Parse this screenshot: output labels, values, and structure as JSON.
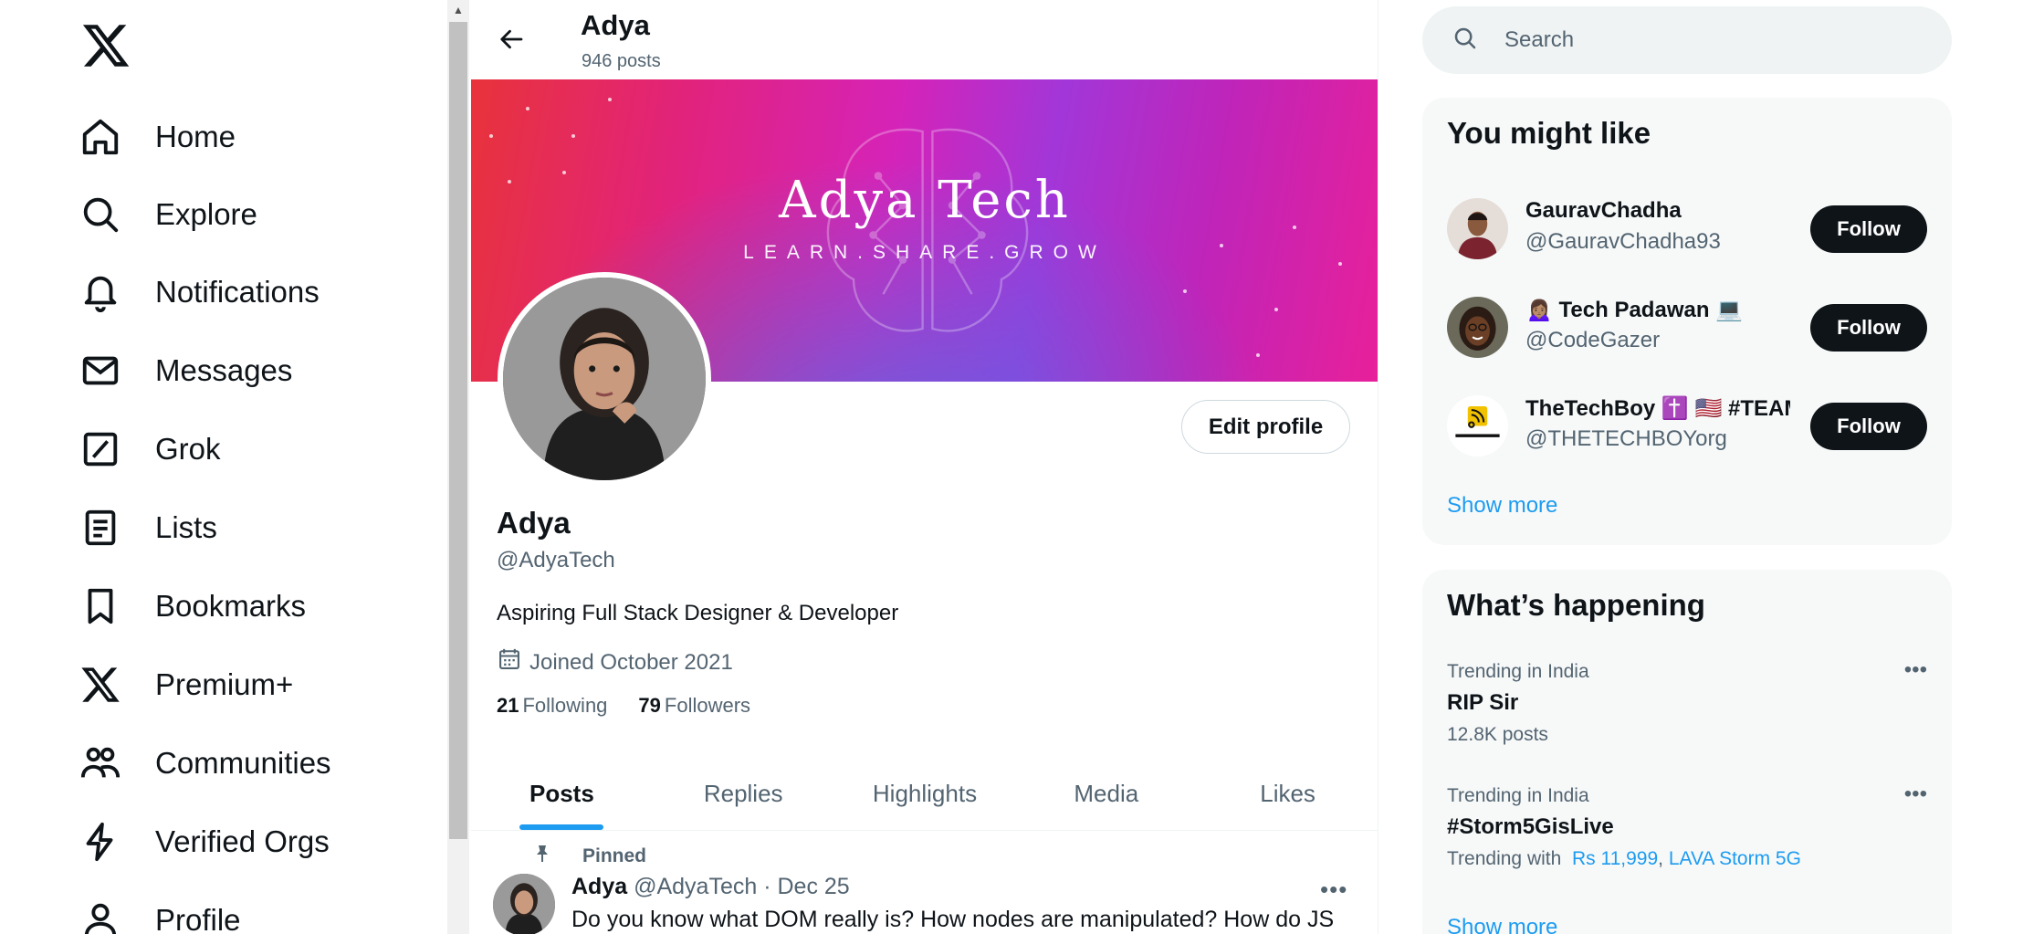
{
  "nav": {
    "items": [
      {
        "label": "Home",
        "icon": "home-icon"
      },
      {
        "label": "Explore",
        "icon": "search-icon"
      },
      {
        "label": "Notifications",
        "icon": "bell-icon"
      },
      {
        "label": "Messages",
        "icon": "envelope-icon"
      },
      {
        "label": "Grok",
        "icon": "grok-icon"
      },
      {
        "label": "Lists",
        "icon": "list-icon"
      },
      {
        "label": "Bookmarks",
        "icon": "bookmark-icon"
      },
      {
        "label": "Premium+",
        "icon": "x-logo-icon"
      },
      {
        "label": "Communities",
        "icon": "people-icon"
      },
      {
        "label": "Verified Orgs",
        "icon": "lightning-icon"
      },
      {
        "label": "Profile",
        "icon": "person-icon"
      }
    ]
  },
  "header": {
    "name": "Adya",
    "posts": "946 posts"
  },
  "banner": {
    "title": "Adya Tech",
    "tagline": "LEARN.SHARE.GROW"
  },
  "profile": {
    "name": "Adya",
    "handle": "@AdyaTech",
    "bio": "Aspiring Full Stack Designer & Developer",
    "joined": "Joined October 2021",
    "following_count": "21",
    "following_label": "Following",
    "followers_count": "79",
    "followers_label": "Followers",
    "edit_label": "Edit profile"
  },
  "tabs": [
    {
      "label": "Posts",
      "active": true
    },
    {
      "label": "Replies"
    },
    {
      "label": "Highlights"
    },
    {
      "label": "Media"
    },
    {
      "label": "Likes"
    }
  ],
  "tweet": {
    "pinned_label": "Pinned",
    "author": "Adya",
    "handle": "@AdyaTech",
    "date": "· Dec 25",
    "text": "Do you know what DOM really is? How nodes are manipulated? How do JS"
  },
  "search": {
    "placeholder": "Search"
  },
  "who_to_follow": {
    "title": "You might like",
    "users": [
      {
        "name": "GauravChadha",
        "handle": "@GauravChadha93",
        "button": "Follow"
      },
      {
        "name": "🙍🏽‍♀️ Tech Padawan 💻",
        "handle": "@CodeGazer",
        "button": "Follow"
      },
      {
        "name": "TheTechBoy ✝️ 🇺🇸 #TEAM",
        "handle": "@THETECHBOYorg",
        "button": "Follow"
      }
    ],
    "show_more": "Show more"
  },
  "trends": {
    "title": "What’s happening",
    "items": [
      {
        "meta": "Trending in India",
        "name": "RIP Sir",
        "sub": "12.8K posts"
      },
      {
        "meta": "Trending in India",
        "name": "#Storm5GisLive",
        "sub_prefix": "Trending with",
        "links": [
          "Rs 11,999",
          "LAVA Storm 5G"
        ]
      }
    ],
    "show_more": "Show more"
  },
  "colors": {
    "accent": "#1d9bf0",
    "text": "#0f1419",
    "muted": "#536471",
    "card_bg": "#f7f9f9"
  }
}
